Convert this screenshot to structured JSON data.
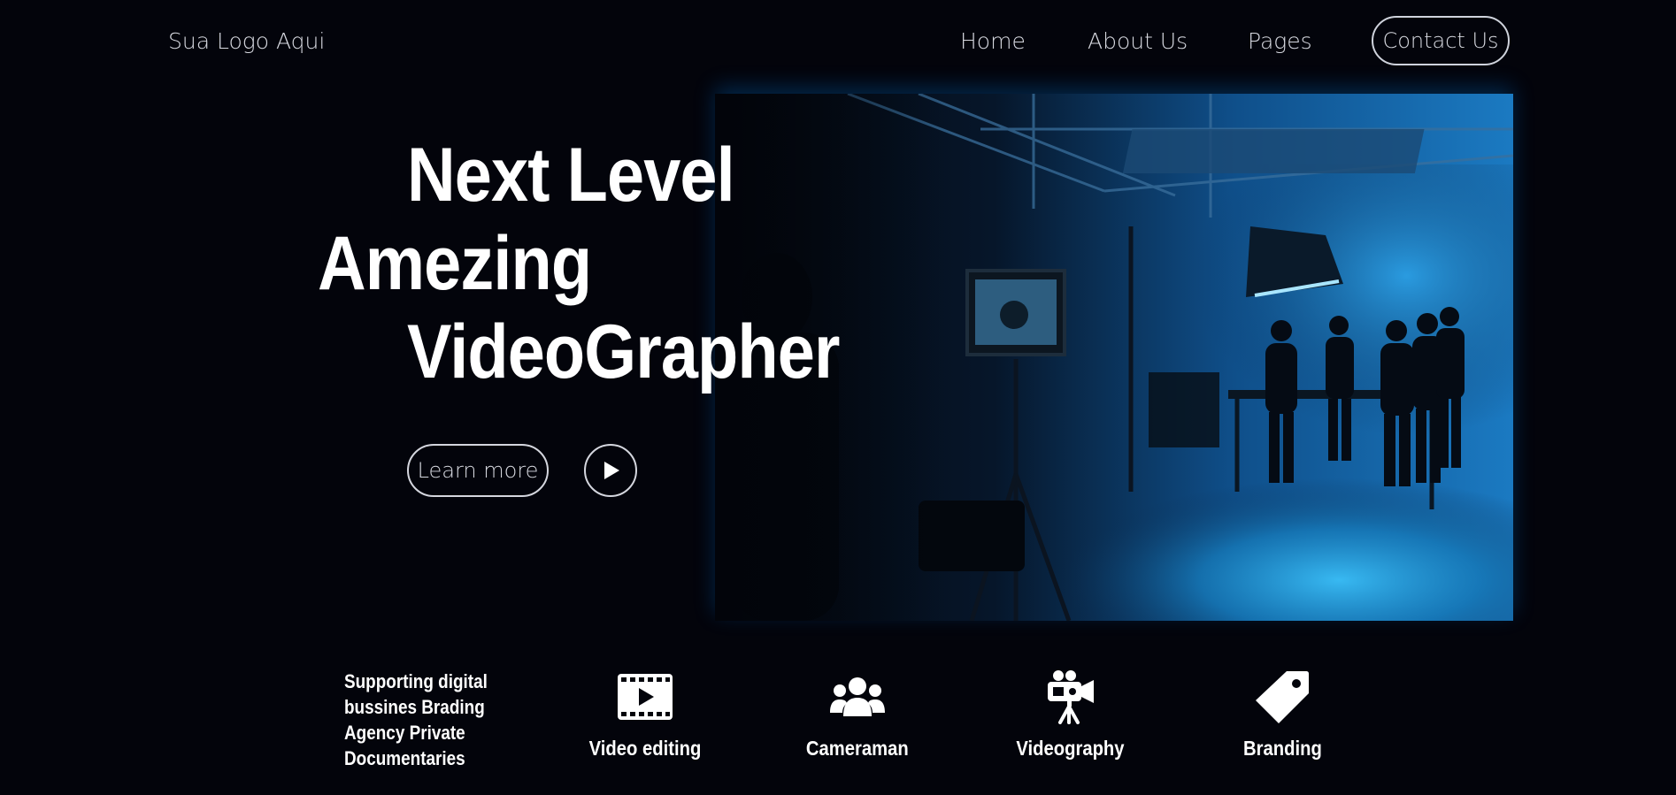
{
  "header": {
    "logo": "Sua Logo Aqui",
    "nav": [
      {
        "label": "Home"
      },
      {
        "label": "About Us"
      },
      {
        "label": "Pages"
      }
    ],
    "contact_label": "Contact Us"
  },
  "hero": {
    "line1": "Next Level",
    "line2": "Amezing",
    "line3": "VideoGrapher",
    "learn_more_label": "Learn more",
    "play_icon": "play-icon",
    "photo_icon": "video-studio-photo"
  },
  "services": {
    "intro": "Supporting digital bussines Brading Agency Private Documentaries",
    "items": [
      {
        "label": "Video editing",
        "icon": "film-play-icon"
      },
      {
        "label": "Cameraman",
        "icon": "users-group-icon"
      },
      {
        "label": "Videography",
        "icon": "video-camera-tripod-icon"
      },
      {
        "label": "Branding",
        "icon": "tag-icon"
      }
    ]
  },
  "colors": {
    "background": "#03040b",
    "accent": "#1a8fd8",
    "text": "#ffffff",
    "muted_text": "#d7d9e0"
  }
}
